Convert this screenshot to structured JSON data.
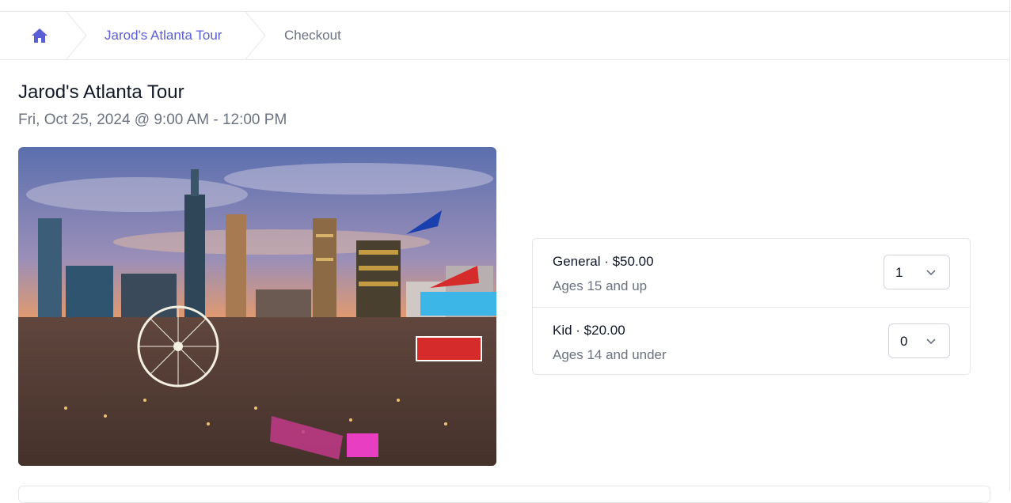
{
  "breadcrumb": {
    "home_icon": "home-icon",
    "tour_label": "Jarod's Atlanta Tour",
    "current_label": "Checkout"
  },
  "event": {
    "title": "Jarod's Atlanta Tour",
    "datetime": "Fri, Oct 25, 2024 @ 9:00 AM - 12:00 PM"
  },
  "tickets": [
    {
      "name": "General · $50.00",
      "description": "Ages 15 and up",
      "quantity": "1"
    },
    {
      "name": "Kid · $20.00",
      "description": "Ages 14 and under",
      "quantity": "0"
    }
  ],
  "colors": {
    "accent": "#5b5fd6",
    "muted_text": "#6b7280",
    "border": "#e5e7eb"
  }
}
